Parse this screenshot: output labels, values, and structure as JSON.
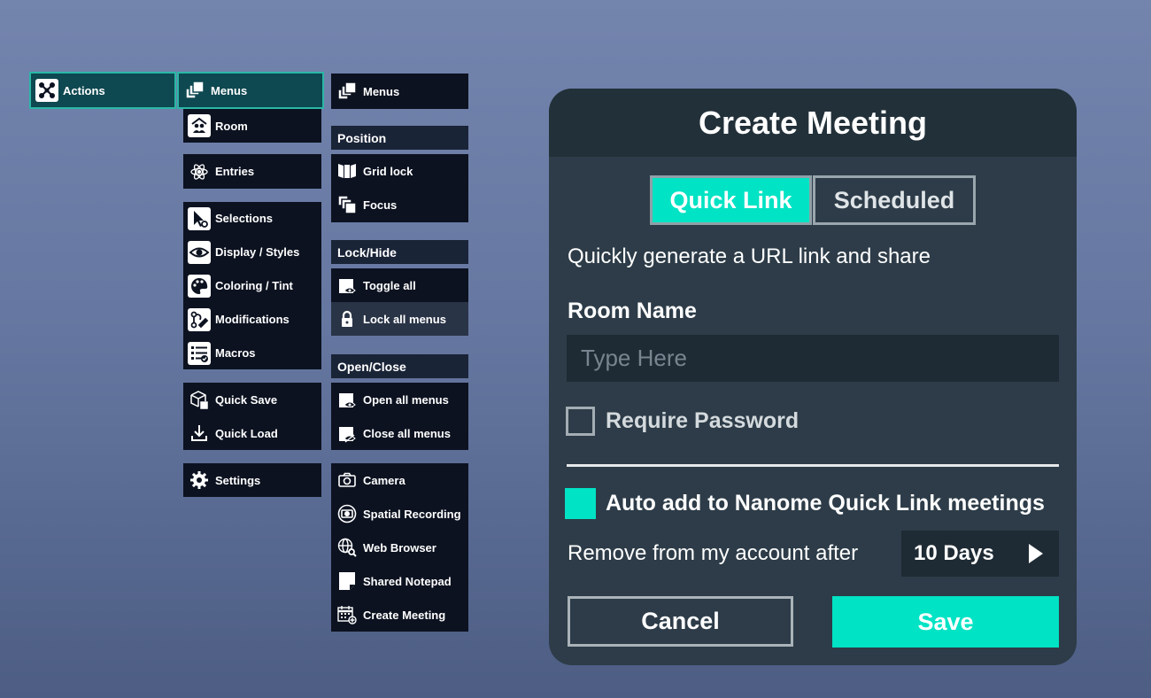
{
  "colors": {
    "accent": "#00e3c4",
    "menu_bg": "#0c1220",
    "menu_header_bg": "#1a2437",
    "panel_bg": "#2d3c48",
    "panel_header_bg": "#223039",
    "active_tab_border": "#2ab7a6"
  },
  "top_tabs": {
    "actions": {
      "label": "Actions",
      "icon": "actions-hub-icon"
    },
    "menus": {
      "label": "Menus",
      "icon": "stacked-windows-icon"
    }
  },
  "menus_column": {
    "room": {
      "label": "Room",
      "icon": "room-people-icon"
    },
    "entries": {
      "label": "Entries",
      "icon": "atom-icon"
    },
    "selections": {
      "label": "Selections",
      "icon": "cursor-gear-icon"
    },
    "display": {
      "label": "Display / Styles",
      "icon": "eye-icon"
    },
    "coloring": {
      "label": "Coloring / Tint",
      "icon": "palette-icon"
    },
    "modifications": {
      "label": "Modifications",
      "icon": "bond-edit-icon"
    },
    "macros": {
      "label": "Macros",
      "icon": "checklist-icon"
    },
    "quick_save": {
      "label": "Quick Save",
      "icon": "box-save-icon"
    },
    "quick_load": {
      "label": "Quick Load",
      "icon": "download-icon"
    },
    "settings": {
      "label": "Settings",
      "icon": "gear-icon"
    }
  },
  "submenu_column": {
    "menus": {
      "label": "Menus",
      "icon": "stacked-windows-icon"
    },
    "position_header": "Position",
    "grid_lock": {
      "label": "Grid lock",
      "icon": "grid-lock-icon"
    },
    "focus": {
      "label": "Focus",
      "icon": "focus-windows-icon"
    },
    "lock_hide_header": "Lock/Hide",
    "toggle_all": {
      "label": "Toggle all",
      "icon": "window-eye-icon"
    },
    "lock_all": {
      "label": "Lock all menus",
      "icon": "lock-icon"
    },
    "open_close_header": "Open/Close",
    "open_all": {
      "label": "Open all menus",
      "icon": "window-eye-icon"
    },
    "close_all": {
      "label": "Close all menus",
      "icon": "window-eye-off-icon"
    },
    "camera": {
      "label": "Camera",
      "icon": "camera-icon"
    },
    "spatial_recording": {
      "label": "Spatial Recording",
      "icon": "recording-icon"
    },
    "web_browser": {
      "label": "Web Browser",
      "icon": "globe-search-icon"
    },
    "shared_notepad": {
      "label": "Shared Notepad",
      "icon": "notepad-icon"
    },
    "create_meeting": {
      "label": "Create Meeting",
      "icon": "calendar-add-icon"
    }
  },
  "dialog": {
    "title": "Create Meeting",
    "tab_quick_link": "Quick Link",
    "tab_scheduled": "Scheduled",
    "description": "Quickly generate a URL link and share",
    "room_name_label": "Room Name",
    "room_name_value": "",
    "room_name_placeholder": "Type Here",
    "require_password_label": "Require Password",
    "require_password_checked": false,
    "auto_add_label": "Auto add to Nanome Quick Link meetings",
    "auto_add_checked": true,
    "remove_after_label": "Remove from my account after",
    "remove_after_value": "10 Days",
    "cancel_label": "Cancel",
    "save_label": "Save"
  }
}
